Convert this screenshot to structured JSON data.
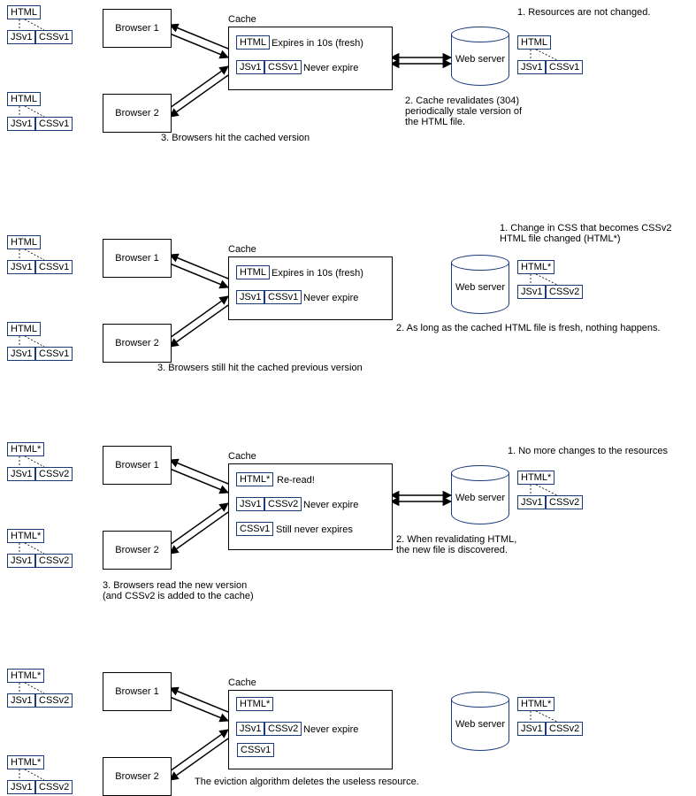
{
  "labels": {
    "html": "HTML",
    "htmlStar": "HTML*",
    "js": "JSv1",
    "css1": "CSSv1",
    "css2": "CSSv2",
    "browser1": "Browser 1",
    "browser2": "Browser 2",
    "cache": "Cache",
    "webServer": "Web server",
    "expiresFresh": "Expires in 10s (fresh)",
    "neverExpire": "Never expire",
    "reread": "Re-read!",
    "stillNever": "Still never expires"
  },
  "scenes": {
    "s1": {
      "n1": "1. Resources are not changed.",
      "n2": "2. Cache revalidates (304)\nperiodically stale version of\nthe HTML file.",
      "n3": "3. Browsers hit the cached version"
    },
    "s2": {
      "n1": "1. Change in CSS that becomes CSSv2\nHTML file changed (HTML*)",
      "n2": "2. As long as the cached HTML file is fresh, nothing happens.",
      "n3": "3. Browsers still hit the cached previous version"
    },
    "s3": {
      "n1": "1. No more changes to the resources",
      "n2": "2. When revalidating HTML,\nthe new file is discovered.",
      "n3": "3. Browsers read the new version\n(and CSSv2 is added to the cache)"
    },
    "s4": {
      "note": "The eviction algorithm deletes the useless resource."
    }
  }
}
